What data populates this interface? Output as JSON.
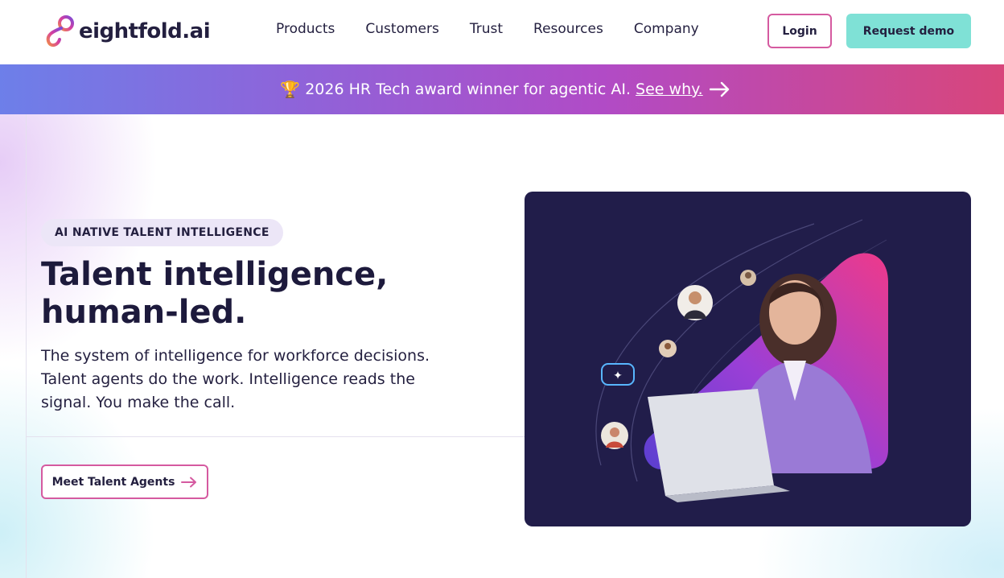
{
  "header": {
    "logo_text": "eightfold.ai",
    "logo_icon": "eightfold-infinity-icon",
    "nav": [
      "Products",
      "Customers",
      "Trust",
      "Resources",
      "Company"
    ],
    "login_label": "Login",
    "demo_label": "Request demo"
  },
  "banner": {
    "icon": "trophy-icon",
    "text": "2026 HR Tech award winner for agentic AI.",
    "link_text": "See why.",
    "arrow_icon": "arrow-right-icon"
  },
  "hero": {
    "eyebrow": "AI NATIVE TALENT INTELLIGENCE",
    "title": "Talent intelligence, human-led.",
    "description": "The system of intelligence for workforce decisions. Talent agents do the work. Intelligence reads the signal. You make the call.",
    "cta_label": "Meet Talent Agents",
    "media_alt": "Smiling woman in purple blazer using a laptop with floating profile avatars"
  },
  "colors": {
    "brand_dark": "#231f3f",
    "accent_pink": "#d55aa0",
    "accent_teal": "#7fe1d6",
    "banner_start": "#6d7fe9",
    "banner_end": "#d8467b",
    "media_bg": "#211d4a"
  }
}
